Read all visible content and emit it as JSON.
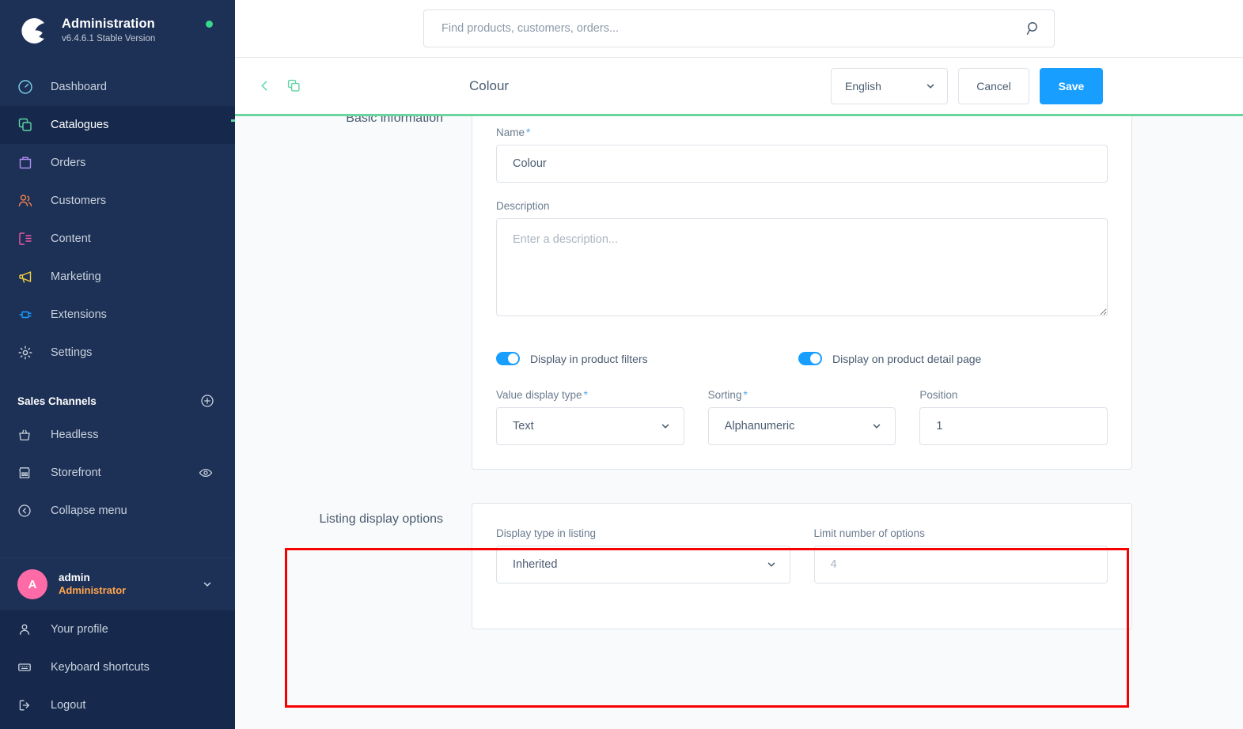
{
  "sidebar": {
    "brand": {
      "title": "Administration",
      "version": "v6.4.6.1 Stable Version",
      "status_color": "#37d88b",
      "logo_icon": "shopware-logo-icon"
    },
    "nav": [
      {
        "label": "Dashboard",
        "icon": "dashboard-icon",
        "color": "#7ad3ea",
        "active": false
      },
      {
        "label": "Catalogues",
        "icon": "catalogues-icon",
        "color": "#5ed6a4",
        "active": true
      },
      {
        "label": "Orders",
        "icon": "orders-icon",
        "color": "#b08ff5",
        "active": false
      },
      {
        "label": "Customers",
        "icon": "customers-icon",
        "color": "#f08050",
        "active": false
      },
      {
        "label": "Content",
        "icon": "content-icon",
        "color": "#f358a3",
        "active": false
      },
      {
        "label": "Marketing",
        "icon": "marketing-icon",
        "color": "#f4d03f",
        "active": false
      },
      {
        "label": "Extensions",
        "icon": "extensions-icon",
        "color": "#189eff",
        "active": false
      },
      {
        "label": "Settings",
        "icon": "settings-icon",
        "color": "#c9d2de",
        "active": false
      }
    ],
    "sales_channels_heading": "Sales Channels",
    "sales_channels": [
      {
        "label": "Headless",
        "icon": "headless-icon"
      },
      {
        "label": "Storefront",
        "icon": "storefront-icon",
        "trailing_icon": "eye-icon"
      },
      {
        "label": "Collapse menu",
        "icon": "collapse-menu-icon"
      }
    ],
    "user": {
      "initial": "A",
      "name": "admin",
      "role": "Administrator",
      "avatar_color": "#ff6ba6"
    },
    "footer_nav": [
      {
        "label": "Your profile",
        "icon": "user-icon"
      },
      {
        "label": "Keyboard shortcuts",
        "icon": "keyboard-icon"
      },
      {
        "label": "Logout",
        "icon": "logout-icon"
      }
    ]
  },
  "search": {
    "placeholder": "Find products, customers, orders...",
    "value": "",
    "icon": "search-icon"
  },
  "smartbar": {
    "back_icon": "chevron-left-icon",
    "duplicate_icon": "copy-icon",
    "title": "Colour",
    "language": "English",
    "language_chevron": "chevron-down-icon",
    "cancel_label": "Cancel",
    "save_label": "Save",
    "save_color": "#189eff"
  },
  "basic_information": {
    "legend": "Basic information",
    "name": {
      "label": "Name",
      "required": true,
      "value": "Colour"
    },
    "description": {
      "label": "Description",
      "required": false,
      "value": "",
      "placeholder": "Enter a description..."
    },
    "switches": [
      {
        "label": "Display in product filters",
        "on": true
      },
      {
        "label": "Display on product detail page",
        "on": true
      }
    ],
    "value_display_type": {
      "label": "Value display type",
      "required": true,
      "value": "Text"
    },
    "sorting": {
      "label": "Sorting",
      "required": true,
      "value": "Alphanumeric"
    },
    "position": {
      "label": "Position",
      "required": false,
      "value": "1"
    }
  },
  "listing_display_options": {
    "legend": "Listing display options",
    "display_type_in_listing": {
      "label": "Display type in listing",
      "value": "Inherited"
    },
    "limit_number_of_options": {
      "label": "Limit number of options",
      "value": "",
      "placeholder": "4"
    },
    "highlight_color": "#f60000"
  }
}
